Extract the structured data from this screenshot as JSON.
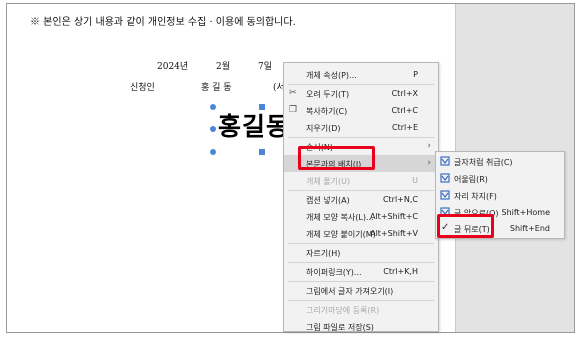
{
  "document": {
    "consent_line": "※ 본인은 상기 내용과 같이 개인정보 수집 · 이용에 동의합니다.",
    "year": "2024년",
    "month": "2월",
    "day": "7일",
    "applicant_label": "신청인",
    "applicant_name": "홍 길 동",
    "applicant_extra": "(서",
    "signature": "홍길동"
  },
  "context_menu": {
    "items": [
      {
        "label": "개체 속성(P)...",
        "shortcut": "P",
        "icon": "",
        "disabled": false,
        "submenu": false
      },
      {
        "label": "오려 두기(T)",
        "shortcut": "Ctrl+X",
        "icon": "scissors-icon",
        "disabled": false,
        "submenu": false
      },
      {
        "label": "복사하기(C)",
        "shortcut": "Ctrl+C",
        "icon": "copy-icon",
        "disabled": false,
        "submenu": false
      },
      {
        "label": "지우기(D)",
        "shortcut": "Ctrl+E",
        "icon": "",
        "disabled": false,
        "submenu": false
      },
      {
        "label": "순서(N)",
        "shortcut": "",
        "icon": "",
        "disabled": false,
        "submenu": true
      },
      {
        "label": "본문과의 배치(J)",
        "shortcut": "",
        "icon": "",
        "disabled": false,
        "submenu": true
      },
      {
        "label": "개체 풀기(U)",
        "shortcut": "U",
        "icon": "",
        "disabled": true,
        "submenu": false
      },
      {
        "label": "캡션 넣기(A)",
        "shortcut": "Ctrl+N,C",
        "icon": "",
        "disabled": false,
        "submenu": false
      },
      {
        "label": "개체 모양 복사(L)...",
        "shortcut": "Alt+Shift+C",
        "icon": "",
        "disabled": false,
        "submenu": false
      },
      {
        "label": "개체 모양 붙이기(M)",
        "shortcut": "Alt+Shift+V",
        "icon": "",
        "disabled": false,
        "submenu": false
      },
      {
        "label": "자르기(H)",
        "shortcut": "",
        "icon": "",
        "disabled": false,
        "submenu": false
      },
      {
        "label": "하이퍼링크(Y)...",
        "shortcut": "Ctrl+K,H",
        "icon": "",
        "disabled": false,
        "submenu": false
      },
      {
        "label": "그림에서 글자 가져오기(I)",
        "shortcut": "",
        "icon": "",
        "disabled": false,
        "submenu": false
      },
      {
        "label": "그리기마당에 등록(R)",
        "shortcut": "",
        "icon": "",
        "disabled": true,
        "submenu": false
      },
      {
        "label": "그림 파일로 저장(S)",
        "shortcut": "",
        "icon": "",
        "disabled": false,
        "submenu": false
      }
    ]
  },
  "submenu": {
    "items": [
      {
        "label": "글자처럼 취급(C)",
        "shortcut": "",
        "checked": false
      },
      {
        "label": "어울림(R)",
        "shortcut": "",
        "checked": false
      },
      {
        "label": "자리 차지(F)",
        "shortcut": "",
        "checked": false
      },
      {
        "label": "글 앞으로(O)",
        "shortcut": "Shift+Home",
        "checked": false
      },
      {
        "label": "글 뒤로(T)",
        "shortcut": "Shift+End",
        "checked": true
      }
    ]
  },
  "colors": {
    "highlight_box": "#e8001c",
    "selection_handle": "#4d86d6",
    "submenu_icon": "#3a6fc4"
  }
}
